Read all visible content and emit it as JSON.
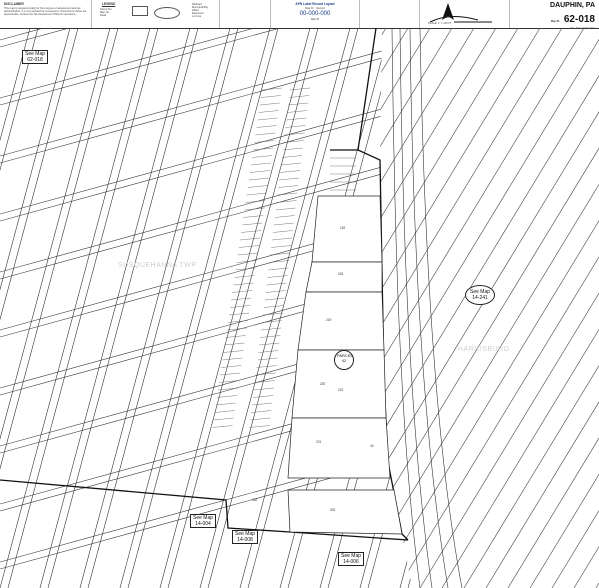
{
  "header": {
    "notes_title": "DISCLAIMER",
    "notes_text": "This map is prepared solely for the purpose of assessment and tax administration. It is not intended for conveyance. Dimensions shown are approximate. Contact the Tax Assessment Office for questions.",
    "legend_title": "LEGEND",
    "legend_items": [
      "Parcel No.",
      "Map No.",
      "Road",
      "Block",
      "Lot"
    ],
    "legend_symbols": [
      "Railroad",
      "Municipal Bdy",
      "Water",
      "Easement",
      "Lot Line"
    ],
    "label_title": "APN Label Record Layout",
    "label_sub": [
      "Map ID",
      "Record"
    ],
    "label_number": "00-000-000",
    "label_foot": "Map ID",
    "county": "DAUPHIN, PA",
    "map_id_label": "Map ID",
    "map_id": "62-018",
    "revision": "Rev Date 01 01 2021",
    "north_caption": "SCALE: 1\" = 100 FT"
  },
  "map": {
    "watermark_left": "SUSQUEHANNA TWP",
    "watermark_right": "HARRISBURG",
    "see_maps": [
      {
        "line1": "See Map",
        "line2": "62-018"
      },
      {
        "line1": "See Map",
        "line2": "14-241"
      },
      {
        "line1": "See Map",
        "line2": "14-004"
      },
      {
        "line1": "See Map",
        "line2": "14-006"
      },
      {
        "line1": "See Map",
        "line2": "14-008"
      }
    ],
    "circle_label": [
      "PARCEL",
      "42"
    ],
    "parcel_numbers": [
      "152",
      "218",
      "219",
      "220",
      "222",
      "221",
      "40",
      "332",
      "002"
    ]
  }
}
